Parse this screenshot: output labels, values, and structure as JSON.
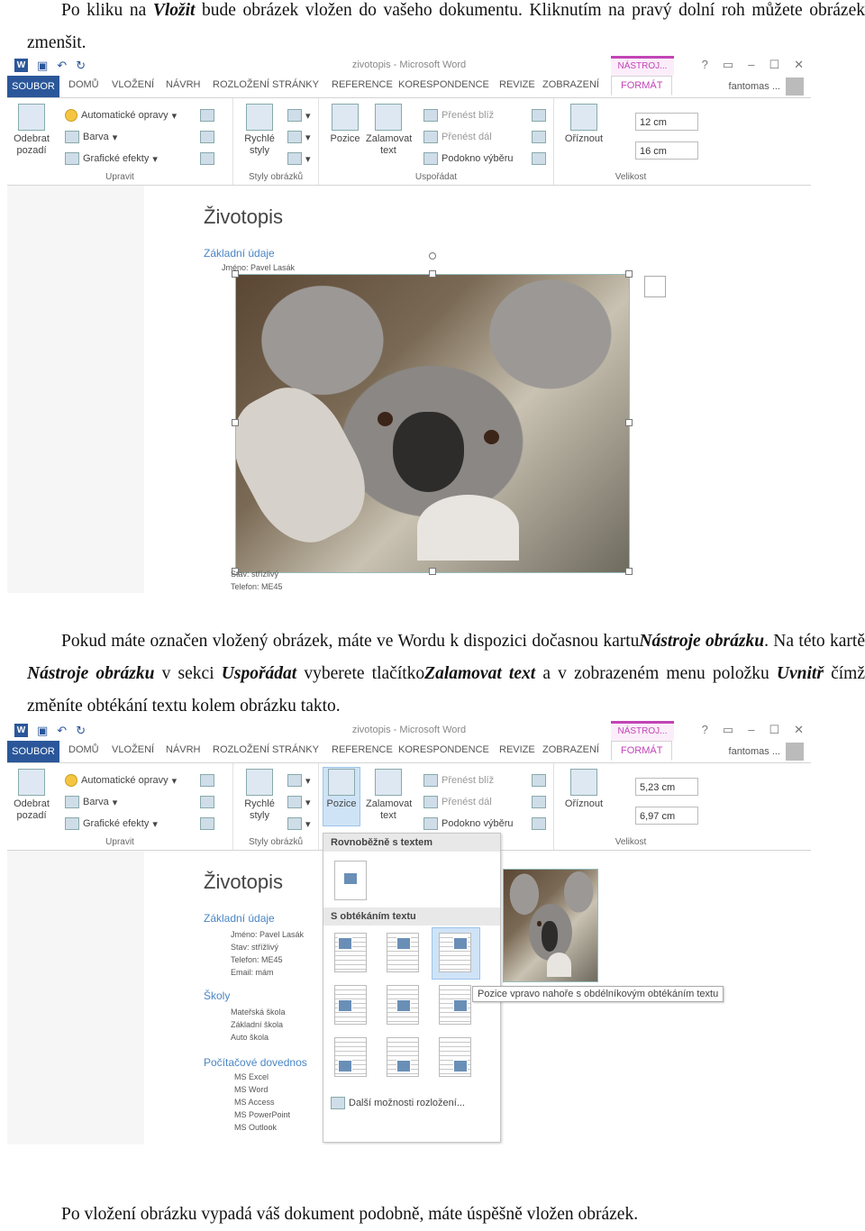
{
  "text": {
    "p1_pre": "Po kliku na ",
    "p1_bold": "Vložit",
    "p1_post": " bude obrázek vložen do vašeho dokumentu. Kliknutím na pravý dolní roh můžete obrázek zmenšit.",
    "p2_a": "Pokud máte označen vložený obrázek, máte ve Wordu k dispozici dočasnou kartu",
    "p2_b": "Nástroje obrázku",
    "p2_c": ". Na této kartě ",
    "p2_d": "Nástroje obrázku",
    "p2_e": " v sekci ",
    "p2_f": "Uspořádat",
    "p2_g": " vyberete tlačítko",
    "p2_h": "Zalamovat text",
    "p2_i": " a v zobrazeném menu položku ",
    "p2_j": "Uvnitř",
    "p2_k": " čímž změníte obtékání textu kolem obrázku takto.",
    "p3": "Po vložení obrázku vypadá váš dokument podobně, máte úspěšně vložen obrázek."
  },
  "word": {
    "window_title": "zivotopis - Microsoft Word",
    "context_tab": "NÁSTROJ...",
    "tabs": [
      "SOUBOR",
      "DOMŮ",
      "VLOŽENÍ",
      "NÁVRH",
      "ROZLOŽENÍ STRÁNKY",
      "REFERENCE",
      "KORESPONDENCE",
      "REVIZE",
      "ZOBRAZENÍ",
      "FORMÁT"
    ],
    "user": "fantomas ...",
    "ribbon": {
      "remove_bg": "Odebrat pozadí",
      "corrections": "Automatické opravy",
      "color": "Barva",
      "effects": "Grafické efekty",
      "group_adjust": "Upravit",
      "quick_styles": "Rychlé styly",
      "group_styles": "Styly obrázků",
      "position": "Pozice",
      "wrap_text": "Zalamovat text",
      "bring_forward": "Přenést blíž",
      "send_backward": "Přenést dál",
      "selection_pane": "Podokno výběru",
      "group_arrange": "Uspořádat",
      "crop": "Oříznout",
      "group_size": "Velikost"
    },
    "shot1": {
      "height": "12 cm",
      "width": "16 cm"
    },
    "shot2": {
      "height": "5,23 cm",
      "width": "6,97 cm"
    },
    "doc": {
      "title": "Životopis",
      "h_basic": "Základní údaje",
      "name": "Jméno: Pavel Lasák",
      "status": "Stav: střížlivý",
      "phone": "Telefon: ME45",
      "email": "Email: mám",
      "h_schools": "Školy",
      "school1": "Mateřská škola",
      "school2": "Základní škola",
      "school3": "Auto škola",
      "h_skills": "Počítačové dovednos",
      "skill1": "MS Excel",
      "skill2": "MS Word",
      "skill3": "MS Access",
      "skill4": "MS PowerPoint",
      "skill5": "MS Outlook",
      "status_short": "Stav: střízlivý",
      "phone_short": "Telefon: ME45"
    },
    "menu": {
      "h_inline": "Rovnoběžně s textem",
      "h_wrap": "S obtékáním textu",
      "more": "Další možnosti rozložení...",
      "tooltip": "Pozice vpravo nahoře s obdélníkovým obtékáním textu"
    }
  }
}
